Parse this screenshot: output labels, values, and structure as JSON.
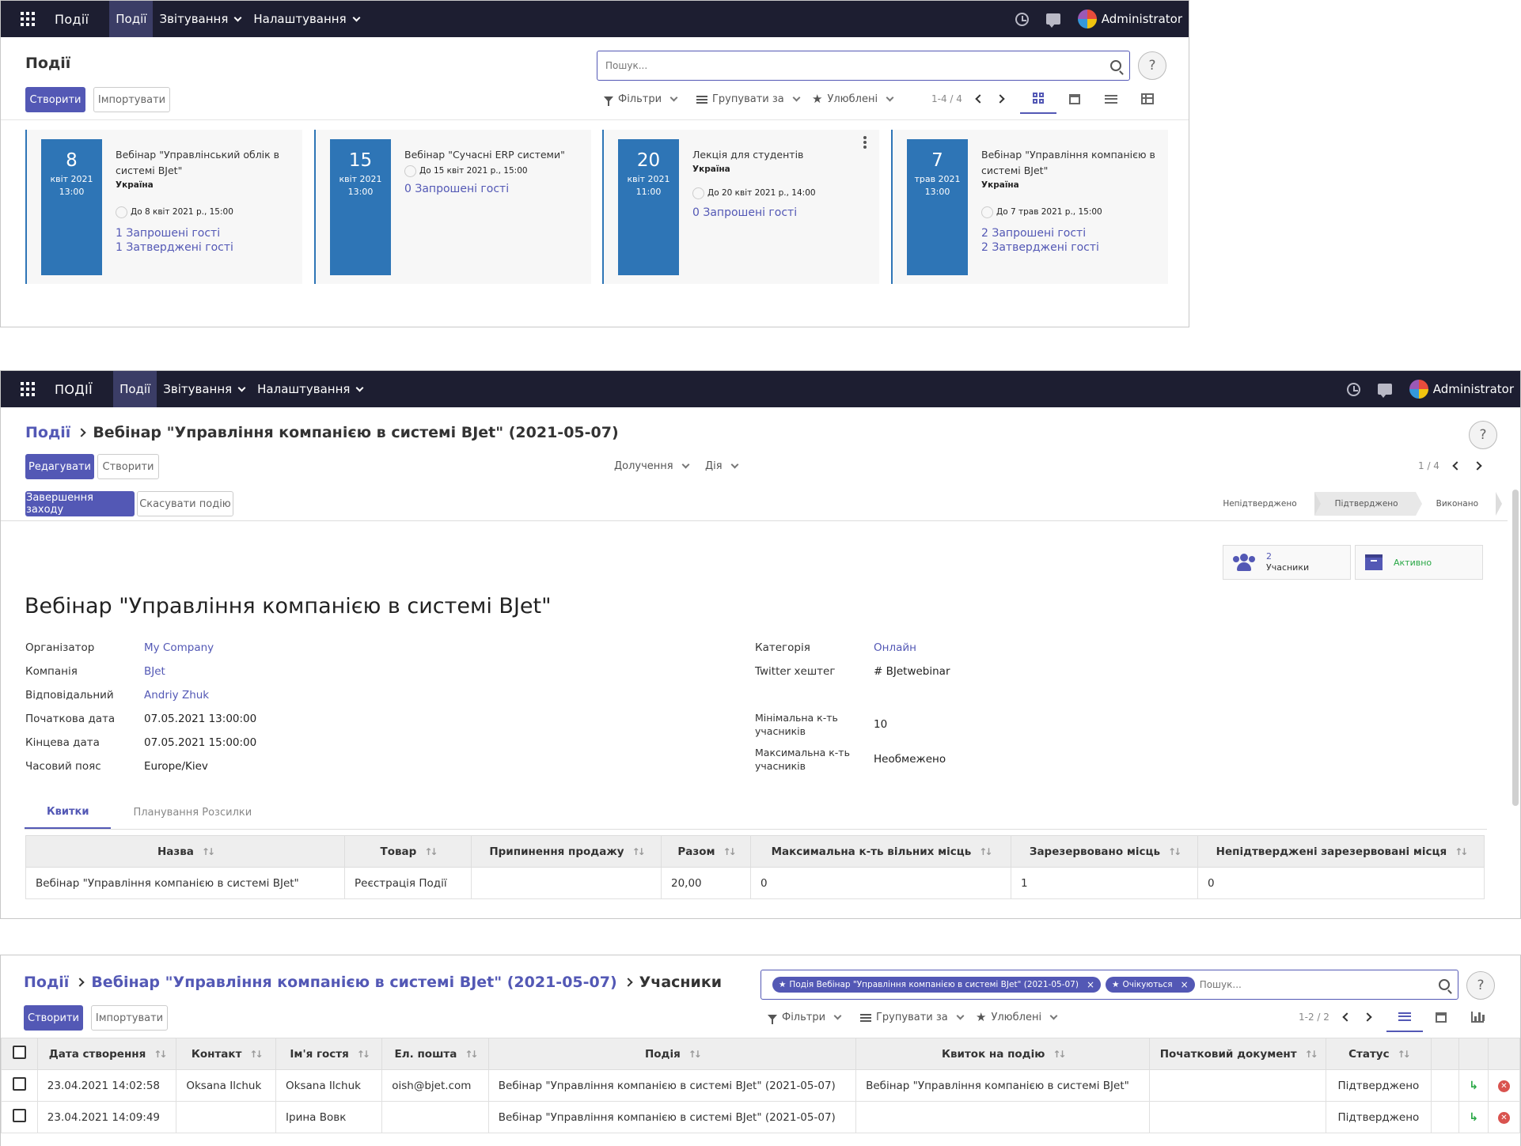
{
  "nav": {
    "brand1": "Події",
    "brand2": "ПОДІЇ",
    "menu": [
      "Події",
      "Звітування",
      "Налаштування"
    ],
    "user": "Administrator"
  },
  "kanban": {
    "title": "Події",
    "create": "Створити",
    "import": "Імпортувати",
    "search_placeholder": "Пошук...",
    "filters": "Фільтри",
    "groupby": "Групувати за",
    "favorites": "Улюблені",
    "pager": "1-4 / 4",
    "cards": [
      {
        "day": "8",
        "month": "квіт 2021",
        "time": "13:00",
        "name": "Вебінар \"Управлінський облік в системі BJet\"",
        "location": "Україна",
        "until": "До 8 квіт 2021 р., 15:00",
        "invited": "1 Запрошені гості",
        "confirmed": "1 Затверджені гості"
      },
      {
        "day": "15",
        "month": "квіт 2021",
        "time": "13:00",
        "name": "Вебінар \"Сучасні ERP системи\"",
        "location": "",
        "until": "До 15 квіт 2021 р., 15:00",
        "invited": "0 Запрошені гості",
        "confirmed": ""
      },
      {
        "day": "20",
        "month": "квіт 2021",
        "time": "11:00",
        "name": "Лекція для студентів",
        "location": "Україна",
        "until": "До 20 квіт 2021 р., 14:00",
        "invited": "0 Запрошені гості",
        "confirmed": ""
      },
      {
        "day": "7",
        "month": "трав 2021",
        "time": "13:00",
        "name": "Вебінар \"Управління компанією в системі BJet\"",
        "location": "Україна",
        "until": "До 7 трав 2021 р., 15:00",
        "invited": "2 Запрошені гості",
        "confirmed": "2 Затверджені гості"
      }
    ]
  },
  "form": {
    "bc_root": "Події",
    "bc_current": "Вебінар \"Управління компанією в системі BJet\" (2021-05-07)",
    "edit": "Редагувати",
    "create": "Створити",
    "attach": "Долучення",
    "action": "Дія",
    "pager": "1 / 4",
    "finish": "Завершення заходу",
    "cancel": "Скасувати подію",
    "stages": [
      "Непідтверджено",
      "Підтверджено",
      "Виконано"
    ],
    "attendees_count": "2",
    "attendees_label": "Учасники",
    "active_label": "Активно",
    "title": "Вебінар \"Управління компанією в системі BJet\"",
    "left_fields": [
      {
        "label": "Організатор",
        "value": "My Company",
        "link": true
      },
      {
        "label": "Компанія",
        "value": "BJet",
        "link": true
      },
      {
        "label": "Відповідальний",
        "value": "Andriy Zhuk",
        "link": true
      },
      {
        "label": "Початкова дата",
        "value": "07.05.2021 13:00:00",
        "link": false
      },
      {
        "label": "Кінцева дата",
        "value": "07.05.2021 15:00:00",
        "link": false
      },
      {
        "label": "Часовий пояс",
        "value": "Europe/Kiev",
        "link": false
      }
    ],
    "category_label": "Категорія",
    "category": "Онлайн",
    "twitter_label": "Twitter хештег",
    "twitter": "# BJetwebinar",
    "min_label": "Мінімальна к-ть учасників",
    "min": "10",
    "max_label": "Максимальна к-ть учасників",
    "max": "Необмежено",
    "tabs": [
      "Квитки",
      "Планування Розсилки"
    ],
    "ticket_cols": [
      "Назва",
      "Товар",
      "Припинення продажу",
      "Разом",
      "Максимальна к-ть вільних місць",
      "Зарезервовано місць",
      "Непідтверджені зарезервовані місця"
    ],
    "ticket_row": [
      "Вебінар \"Управління компанією в системі BJet\"",
      "Реєстрація Події",
      "",
      "20,00",
      "0",
      "1",
      "0"
    ]
  },
  "attendees": {
    "bc_root": "Події",
    "bc_event": "Вебінар \"Управління компанією в системі BJet\" (2021-05-07)",
    "bc_current": "Учасники",
    "facet1": "Подія Вебінар \"Управління компанією в системі BJet\" (2021-05-07)",
    "facet2": "Очікуються",
    "search_placeholder": "Пошук...",
    "create": "Створити",
    "import": "Імпортувати",
    "filters": "Фільтри",
    "groupby": "Групувати за",
    "favorites": "Улюблені",
    "pager": "1-2 / 2",
    "cols": [
      "Дата створення",
      "Контакт",
      "Ім'я гостя",
      "Ел. пошта",
      "Подія",
      "Квиток на подію",
      "Початковий документ",
      "Статус"
    ],
    "rows": [
      [
        "23.04.2021 14:02:58",
        "Oksana Ilchuk",
        "Oksana Ilchuk",
        "oish@bjet.com",
        "Вебінар \"Управління компанією в системі BJet\" (2021-05-07)",
        "Вебінар \"Управління компанією в системі BJet\"",
        "",
        "Підтверджено"
      ],
      [
        "23.04.2021 14:09:49",
        "",
        "Ірина Вовк",
        "",
        "Вебінар \"Управління компанією в системі BJet\" (2021-05-07)",
        "",
        "",
        "Підтверджено"
      ]
    ]
  },
  "colors": {
    "navbar": "#1d1e31",
    "primary": "#5358b5",
    "card_date": "#2e75b6"
  }
}
